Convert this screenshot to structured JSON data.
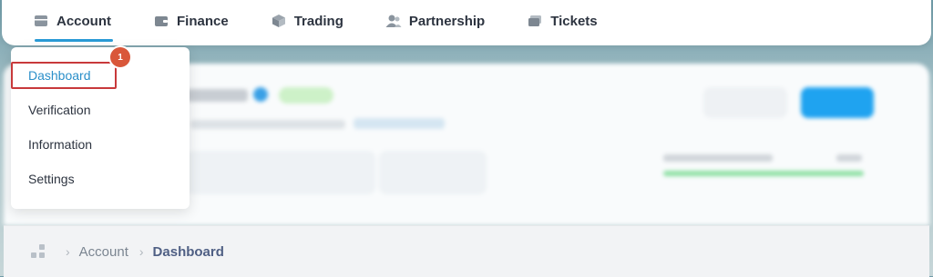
{
  "nav": {
    "items": [
      {
        "label": "Account",
        "icon": "account-icon",
        "active": true
      },
      {
        "label": "Finance",
        "icon": "wallet-icon",
        "active": false
      },
      {
        "label": "Trading",
        "icon": "cube-icon",
        "active": false
      },
      {
        "label": "Partnership",
        "icon": "users-icon",
        "active": false
      },
      {
        "label": "Tickets",
        "icon": "ticket-icon",
        "active": false
      }
    ]
  },
  "dropdown": {
    "items": [
      {
        "label": "Dashboard",
        "active": true
      },
      {
        "label": "Verification",
        "active": false
      },
      {
        "label": "Information",
        "active": false
      },
      {
        "label": "Settings",
        "active": false
      }
    ],
    "badge": "1"
  },
  "breadcrumb": {
    "parent": "Account",
    "current": "Dashboard"
  },
  "colors": {
    "accent": "#2a9bd6",
    "highlight": "#c8393b",
    "badge": "#d9573a"
  }
}
